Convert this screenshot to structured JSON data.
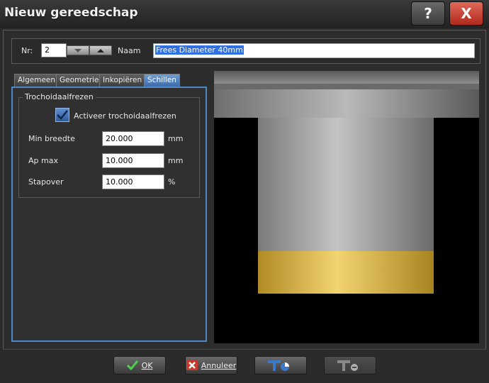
{
  "window": {
    "title": "Nieuw gereedschap",
    "help_label": "?",
    "close_label": "X"
  },
  "header": {
    "nr_label": "Nr:",
    "nr_value": "2",
    "naam_label": "Naam",
    "naam_value": "Frees Diameter 40mm"
  },
  "tabs": [
    {
      "label": "Algemeen",
      "active": false
    },
    {
      "label": "Geometrie",
      "active": false
    },
    {
      "label": "Inkopiëren",
      "active": false
    },
    {
      "label": "Schillen",
      "active": true
    }
  ],
  "group": {
    "title": "Trochoidaalfrezen",
    "checkbox_label": "Activeer trochoidaalfrezen",
    "checked": true,
    "fields": [
      {
        "label": "Min breedte",
        "value": "20.000",
        "unit": "mm"
      },
      {
        "label": "Ap max",
        "value": "10.000",
        "unit": "mm"
      },
      {
        "label": "Stapover",
        "value": "10.000",
        "unit": "%"
      }
    ]
  },
  "buttons": {
    "ok": "OK",
    "cancel": "Annuleer"
  },
  "colors": {
    "accent": "#4d88c8",
    "close": "#c8392b",
    "tool_body": "#a8a8a8",
    "tool_tip": "#e0b84a"
  }
}
